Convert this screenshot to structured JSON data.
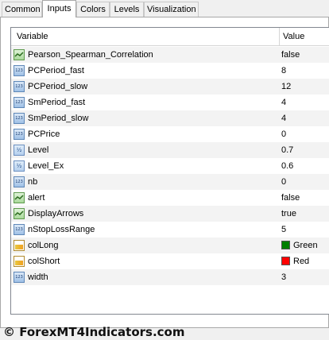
{
  "tabs": [
    {
      "label": "Common"
    },
    {
      "label": "Inputs"
    },
    {
      "label": "Colors"
    },
    {
      "label": "Levels"
    },
    {
      "label": "Visualization"
    }
  ],
  "active_tab": "Inputs",
  "table": {
    "headers": {
      "variable": "Variable",
      "value": "Value"
    },
    "rows": [
      {
        "name": "Pearson_Spearman_Correlation",
        "value": "false",
        "icon": "bool-icon"
      },
      {
        "name": "PCPeriod_fast",
        "value": "8",
        "icon": "int-icon"
      },
      {
        "name": "PCPeriod_slow",
        "value": "12",
        "icon": "int-icon"
      },
      {
        "name": "SmPeriod_fast",
        "value": "4",
        "icon": "int-icon"
      },
      {
        "name": "SmPeriod_slow",
        "value": "4",
        "icon": "int-icon"
      },
      {
        "name": "PCPrice",
        "value": "0",
        "icon": "int-icon"
      },
      {
        "name": "Level",
        "value": "0.7",
        "icon": "double-icon"
      },
      {
        "name": "Level_Ex",
        "value": "0.6",
        "icon": "double-icon"
      },
      {
        "name": "nb",
        "value": "0",
        "icon": "int-icon"
      },
      {
        "name": "alert",
        "value": "false",
        "icon": "bool-icon"
      },
      {
        "name": "DisplayArrows",
        "value": "true",
        "icon": "bool-icon"
      },
      {
        "name": "nStopLossRange",
        "value": "5",
        "icon": "int-icon"
      },
      {
        "name": "colLong",
        "value": "Green",
        "icon": "color-icon",
        "swatch": "#007f00"
      },
      {
        "name": "colShort",
        "value": "Red",
        "icon": "color-icon",
        "swatch": "#ff0000"
      },
      {
        "name": "width",
        "value": "3",
        "icon": "int-icon"
      }
    ]
  },
  "watermark": "© ForexMT4Indicators.com"
}
